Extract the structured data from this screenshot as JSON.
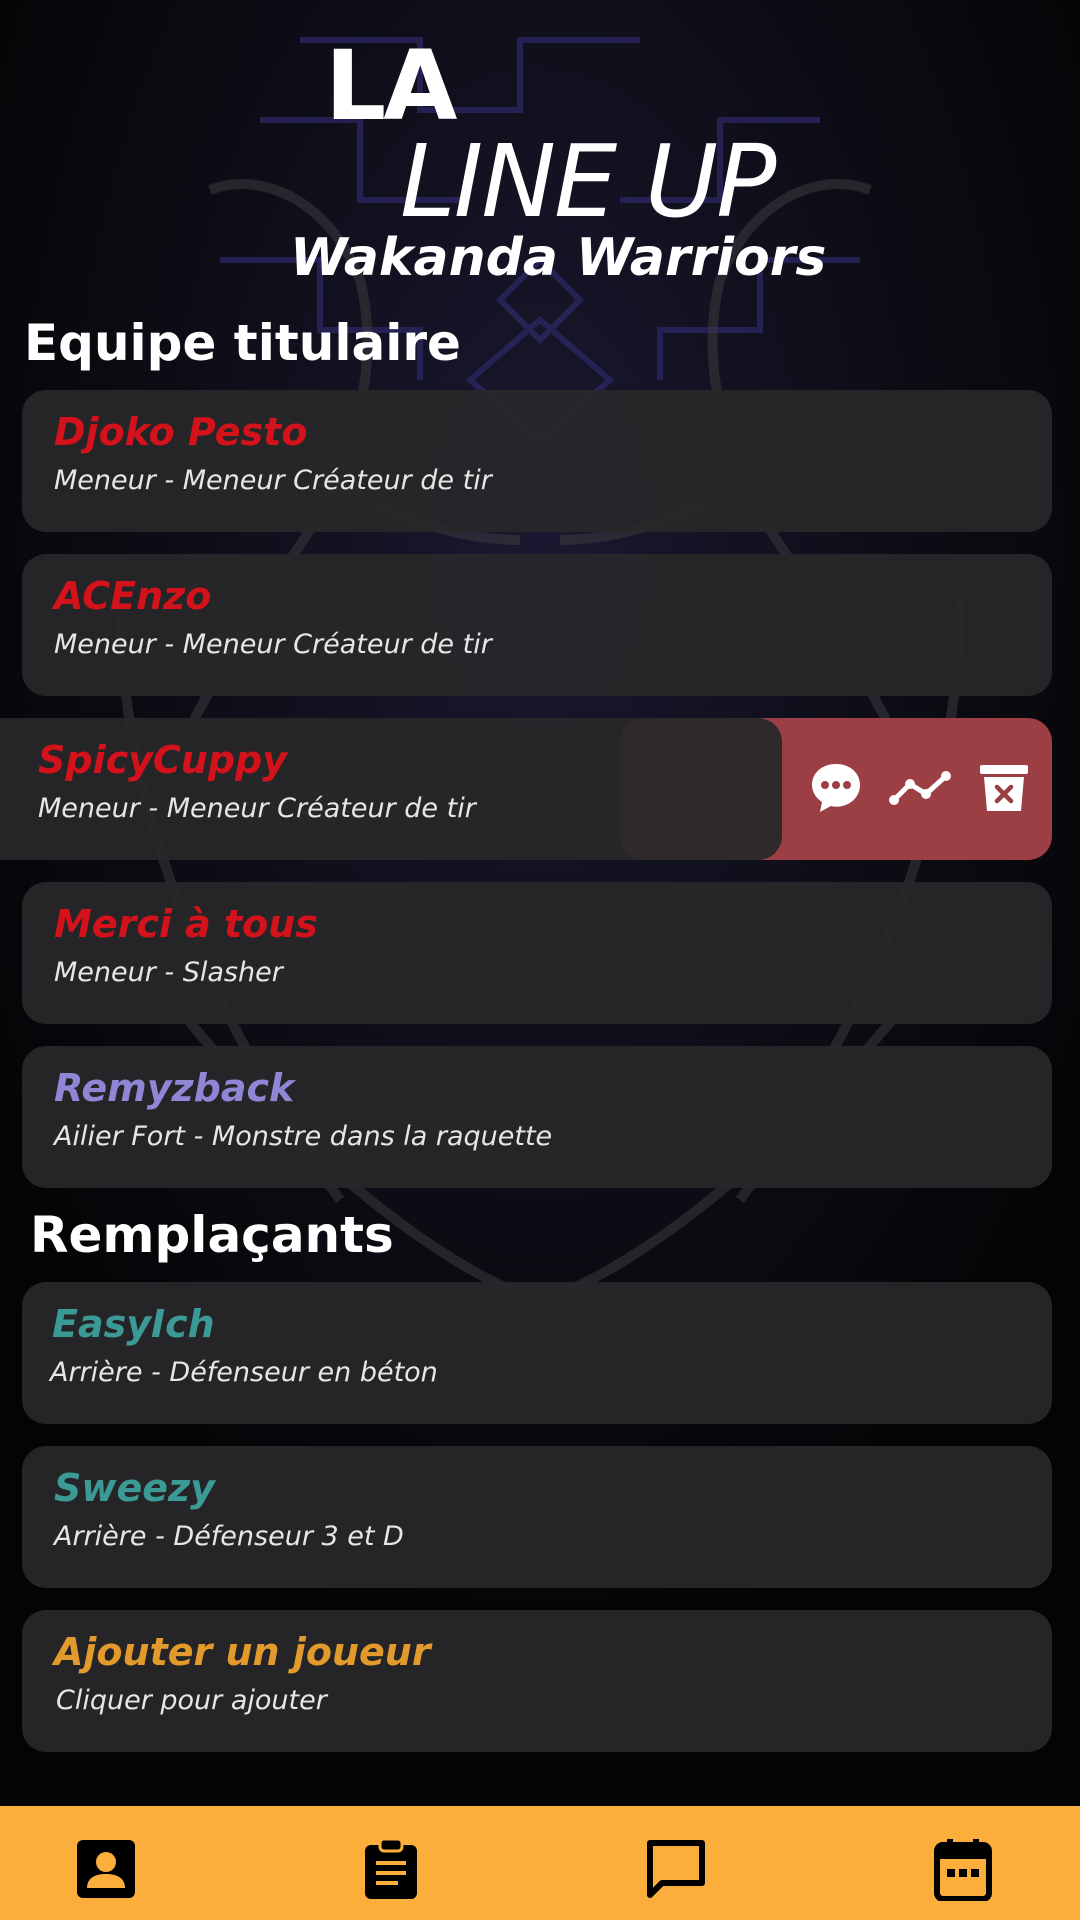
{
  "header": {
    "title_la": "LA",
    "title_lineup": "LINE UP",
    "team_name": "Wakanda Warriors"
  },
  "colors": {
    "red_player": "#d4121b",
    "purple_player": "#8f86d6",
    "teal_player": "#3b9a96",
    "add_player": "#e39a2c",
    "swipe_bg": "#9c3f44",
    "nav_bg": "#fcae3c"
  },
  "starters": {
    "title": "Equipe titulaire",
    "players": [
      {
        "name": "Djoko Pesto",
        "role": "Meneur - Meneur Créateur de tir"
      },
      {
        "name": "ACEnzo",
        "role": "Meneur - Meneur Créateur de tir"
      },
      {
        "name": "SpicyCuppy",
        "role": "Meneur - Meneur Créateur de tir"
      },
      {
        "name": "Merci à tous",
        "role": "Meneur - Slasher"
      },
      {
        "name": "Remyzback",
        "role": "Ailier Fort - Monstre dans la raquette"
      }
    ]
  },
  "swipe_actions": [
    "chat-bubble-icon",
    "stats-trend-icon",
    "delete-icon"
  ],
  "substitutes": {
    "title": "Remplaçants",
    "players": [
      {
        "name": "EasyIch",
        "role": "Arrière - Défenseur en béton"
      },
      {
        "name": "Sweezy",
        "role": "Arrière - Défenseur 3 et D"
      }
    ]
  },
  "add_player": {
    "label": "Ajouter un joueur",
    "hint": "Cliquer pour ajouter"
  },
  "bottom_nav": [
    "profile-icon",
    "clipboard-icon",
    "chat-icon",
    "calendar-icon"
  ]
}
